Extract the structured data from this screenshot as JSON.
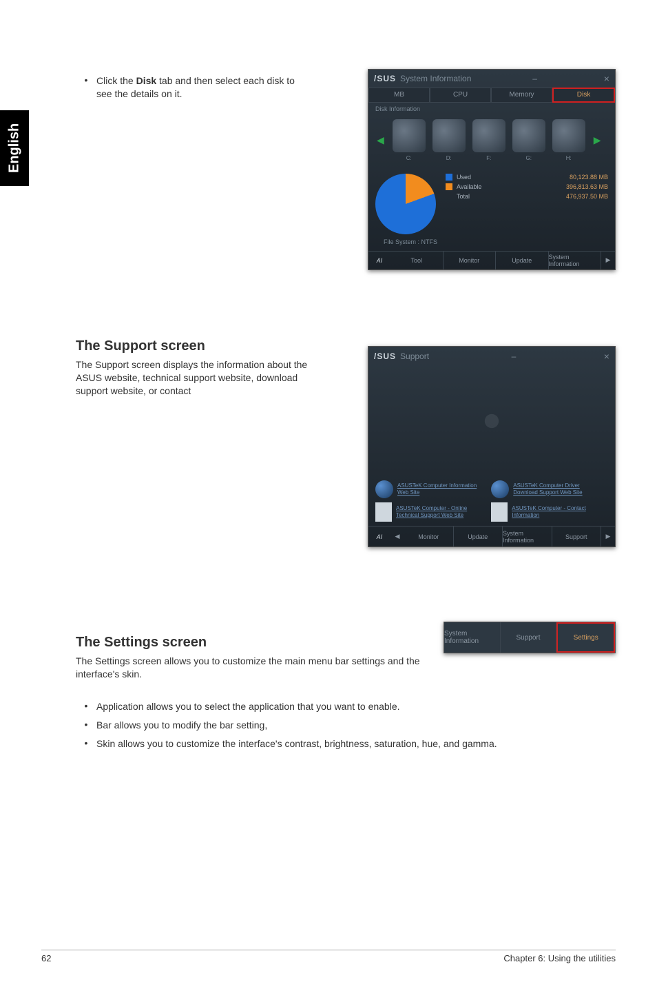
{
  "sideTab": "English",
  "top": {
    "bullet": "•",
    "text_prefix": "Click the ",
    "text_bold": "Disk",
    "text_suffix": " tab and then select each disk to see the details on it."
  },
  "support": {
    "heading": "The Support screen",
    "para": "The Support screen displays the information about the ASUS website, technical support website, download support website, or contact"
  },
  "settings": {
    "heading": "The Settings screen",
    "para": "The Settings screen allows you to customize the main menu bar settings and the interface's skin.",
    "items": [
      "Application allows you to select the application that you want to enable.",
      "Bar allows you to modify the bar setting,",
      "Skin allows you to customize the interface's contrast, brightness, saturation, hue, and gamma."
    ]
  },
  "footer": {
    "left": "62",
    "right": "Chapter 6: Using the utilities"
  },
  "shot1": {
    "brand": "/SUS",
    "title": "System Information",
    "tabs": [
      "MB",
      "CPU",
      "Memory",
      "Disk"
    ],
    "activeTab": 3,
    "sub": "Disk Information",
    "diskLabels": [
      "C:",
      "D:",
      "F:",
      "G:",
      "H:"
    ],
    "fs": "File System : NTFS",
    "used": {
      "label": "Used",
      "value": "80,123.88  MB"
    },
    "avail": {
      "label": "Available",
      "value": "396,813.63  MB"
    },
    "total": {
      "label": "Total",
      "value": "476,937.50  MB"
    },
    "footerTabs": [
      "Tool",
      "Monitor",
      "Update",
      "System Information"
    ]
  },
  "shot2": {
    "brand": "/SUS",
    "title": "Support",
    "links": [
      "ASUSTeK Computer Information Web Site",
      "ASUSTeK Computer Driver Download Support Web Site",
      "ASUSTeK Computer - Online Technical Support Web Site",
      "ASUSTeK Computer - Contact Information"
    ],
    "footerTabs": [
      "Monitor",
      "Update",
      "System Information",
      "Support"
    ]
  },
  "shot3": {
    "cells": [
      "System Information",
      "Support",
      "Settings"
    ],
    "active": 2
  }
}
